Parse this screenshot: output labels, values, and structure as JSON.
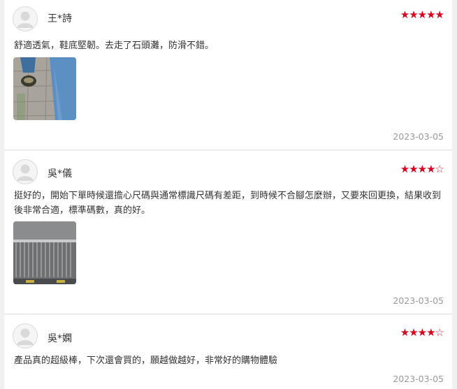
{
  "reviews": [
    {
      "name": "王*詩",
      "rating": 5,
      "text": "舒適透氣，鞋底堅韌。去走了石頭灘，防滑不錯。",
      "date": "2023-03-05",
      "has_photo": true
    },
    {
      "name": "吳*儀",
      "rating": 4,
      "text": "挺好的，開始下單時候還擔心尺碼與通常標識尺碼有差距，到時候不合腳怎麼辦，又要來回更換，結果收到後非常合適，標準碼數，真的好。",
      "date": "2023-03-05",
      "has_photo": true
    },
    {
      "name": "吳*嫻",
      "rating": 4,
      "text": "產品真的超級棒，下次還會買的，願越做越好，非常好的購物體驗",
      "date": "2023-03-05",
      "has_photo": false
    }
  ],
  "colors": {
    "star": "#d8001d",
    "date": "#999999",
    "background": "#f0f0f0"
  }
}
